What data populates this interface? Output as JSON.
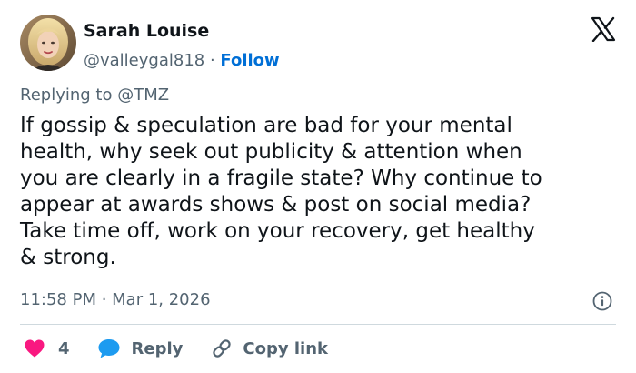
{
  "author": {
    "display_name": "Sarah Louise",
    "handle": "@valleygal818",
    "separator": " · ",
    "follow_label": "Follow"
  },
  "reply_context": {
    "prefix": "Replying to ",
    "mention": "@TMZ"
  },
  "tweet": {
    "text": "If gossip & speculation are bad for your mental\nhealth, why seek out publicity & attention when\nyou are clearly in a fragile state? Why continue to\nappear at awards shows & post on social media?\nTake time off, work on your recovery, get healthy\n& strong.",
    "time": "11:58 PM",
    "meta_separator": " · ",
    "date": "Mar 1, 2026"
  },
  "actions": {
    "like_count": "4",
    "reply_label": "Reply",
    "copy_link_label": "Copy link"
  },
  "icons": {
    "brand": "x-logo-icon",
    "info": "info-icon",
    "like": "heart-icon",
    "reply": "speech-bubble-icon",
    "copy": "link-icon"
  },
  "colors": {
    "text": "#0f1419",
    "secondary": "#536471",
    "follow": "#006fd6",
    "heart": "#f91880",
    "reply_bubble": "#1d9bf0",
    "divider": "#cfd9de"
  }
}
